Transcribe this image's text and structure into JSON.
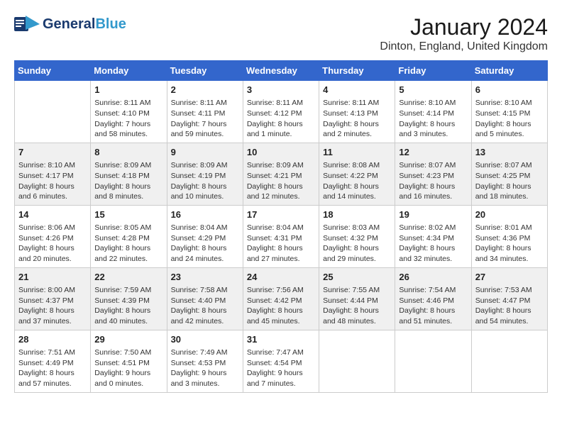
{
  "header": {
    "logo_main": "General",
    "logo_sub": "Blue",
    "month": "January 2024",
    "location": "Dinton, England, United Kingdom"
  },
  "weekdays": [
    "Sunday",
    "Monday",
    "Tuesday",
    "Wednesday",
    "Thursday",
    "Friday",
    "Saturday"
  ],
  "weeks": [
    [
      {
        "day": "",
        "info": ""
      },
      {
        "day": "1",
        "info": "Sunrise: 8:11 AM\nSunset: 4:10 PM\nDaylight: 7 hours\nand 58 minutes."
      },
      {
        "day": "2",
        "info": "Sunrise: 8:11 AM\nSunset: 4:11 PM\nDaylight: 7 hours\nand 59 minutes."
      },
      {
        "day": "3",
        "info": "Sunrise: 8:11 AM\nSunset: 4:12 PM\nDaylight: 8 hours\nand 1 minute."
      },
      {
        "day": "4",
        "info": "Sunrise: 8:11 AM\nSunset: 4:13 PM\nDaylight: 8 hours\nand 2 minutes."
      },
      {
        "day": "5",
        "info": "Sunrise: 8:10 AM\nSunset: 4:14 PM\nDaylight: 8 hours\nand 3 minutes."
      },
      {
        "day": "6",
        "info": "Sunrise: 8:10 AM\nSunset: 4:15 PM\nDaylight: 8 hours\nand 5 minutes."
      }
    ],
    [
      {
        "day": "7",
        "info": "Sunrise: 8:10 AM\nSunset: 4:17 PM\nDaylight: 8 hours\nand 6 minutes."
      },
      {
        "day": "8",
        "info": "Sunrise: 8:09 AM\nSunset: 4:18 PM\nDaylight: 8 hours\nand 8 minutes."
      },
      {
        "day": "9",
        "info": "Sunrise: 8:09 AM\nSunset: 4:19 PM\nDaylight: 8 hours\nand 10 minutes."
      },
      {
        "day": "10",
        "info": "Sunrise: 8:09 AM\nSunset: 4:21 PM\nDaylight: 8 hours\nand 12 minutes."
      },
      {
        "day": "11",
        "info": "Sunrise: 8:08 AM\nSunset: 4:22 PM\nDaylight: 8 hours\nand 14 minutes."
      },
      {
        "day": "12",
        "info": "Sunrise: 8:07 AM\nSunset: 4:23 PM\nDaylight: 8 hours\nand 16 minutes."
      },
      {
        "day": "13",
        "info": "Sunrise: 8:07 AM\nSunset: 4:25 PM\nDaylight: 8 hours\nand 18 minutes."
      }
    ],
    [
      {
        "day": "14",
        "info": "Sunrise: 8:06 AM\nSunset: 4:26 PM\nDaylight: 8 hours\nand 20 minutes."
      },
      {
        "day": "15",
        "info": "Sunrise: 8:05 AM\nSunset: 4:28 PM\nDaylight: 8 hours\nand 22 minutes."
      },
      {
        "day": "16",
        "info": "Sunrise: 8:04 AM\nSunset: 4:29 PM\nDaylight: 8 hours\nand 24 minutes."
      },
      {
        "day": "17",
        "info": "Sunrise: 8:04 AM\nSunset: 4:31 PM\nDaylight: 8 hours\nand 27 minutes."
      },
      {
        "day": "18",
        "info": "Sunrise: 8:03 AM\nSunset: 4:32 PM\nDaylight: 8 hours\nand 29 minutes."
      },
      {
        "day": "19",
        "info": "Sunrise: 8:02 AM\nSunset: 4:34 PM\nDaylight: 8 hours\nand 32 minutes."
      },
      {
        "day": "20",
        "info": "Sunrise: 8:01 AM\nSunset: 4:36 PM\nDaylight: 8 hours\nand 34 minutes."
      }
    ],
    [
      {
        "day": "21",
        "info": "Sunrise: 8:00 AM\nSunset: 4:37 PM\nDaylight: 8 hours\nand 37 minutes."
      },
      {
        "day": "22",
        "info": "Sunrise: 7:59 AM\nSunset: 4:39 PM\nDaylight: 8 hours\nand 40 minutes."
      },
      {
        "day": "23",
        "info": "Sunrise: 7:58 AM\nSunset: 4:40 PM\nDaylight: 8 hours\nand 42 minutes."
      },
      {
        "day": "24",
        "info": "Sunrise: 7:56 AM\nSunset: 4:42 PM\nDaylight: 8 hours\nand 45 minutes."
      },
      {
        "day": "25",
        "info": "Sunrise: 7:55 AM\nSunset: 4:44 PM\nDaylight: 8 hours\nand 48 minutes."
      },
      {
        "day": "26",
        "info": "Sunrise: 7:54 AM\nSunset: 4:46 PM\nDaylight: 8 hours\nand 51 minutes."
      },
      {
        "day": "27",
        "info": "Sunrise: 7:53 AM\nSunset: 4:47 PM\nDaylight: 8 hours\nand 54 minutes."
      }
    ],
    [
      {
        "day": "28",
        "info": "Sunrise: 7:51 AM\nSunset: 4:49 PM\nDaylight: 8 hours\nand 57 minutes."
      },
      {
        "day": "29",
        "info": "Sunrise: 7:50 AM\nSunset: 4:51 PM\nDaylight: 9 hours\nand 0 minutes."
      },
      {
        "day": "30",
        "info": "Sunrise: 7:49 AM\nSunset: 4:53 PM\nDaylight: 9 hours\nand 3 minutes."
      },
      {
        "day": "31",
        "info": "Sunrise: 7:47 AM\nSunset: 4:54 PM\nDaylight: 9 hours\nand 7 minutes."
      },
      {
        "day": "",
        "info": ""
      },
      {
        "day": "",
        "info": ""
      },
      {
        "day": "",
        "info": ""
      }
    ]
  ],
  "row_classes": [
    "row-white",
    "row-shaded",
    "row-white",
    "row-shaded",
    "row-white"
  ]
}
